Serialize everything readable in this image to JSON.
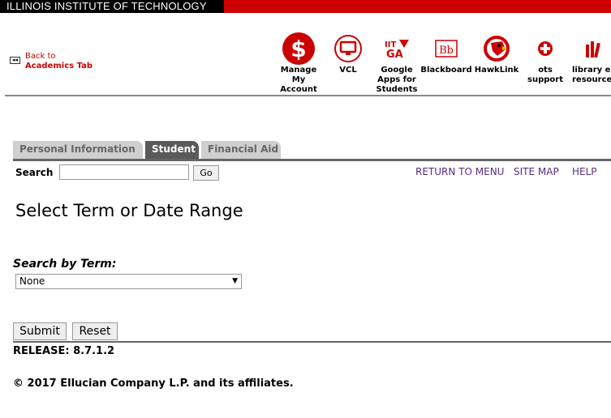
{
  "banner": {
    "title": "ILLINOIS INSTITUTE OF TECHNOLOGY"
  },
  "back": {
    "line1": "Back to",
    "line2": "Academics Tab",
    "icon": "double-left-arrow-icon"
  },
  "quick_links": [
    {
      "label": "Manage\nMy\nAccount",
      "icon": "dollar-icon"
    },
    {
      "label": "VCL",
      "icon": "monitor-icon"
    },
    {
      "label": "Google\nApps for\nStudents",
      "icon": "iit-ga-icon"
    },
    {
      "label": "Blackboard",
      "icon": "bb-icon"
    },
    {
      "label": "HawkLink",
      "icon": "hawk-icon"
    },
    {
      "label": "ots\nsupport",
      "icon": "red-cross-icon"
    },
    {
      "label": "library e\nresource",
      "icon": "books-icon"
    }
  ],
  "tabs": [
    {
      "label": "Personal Information",
      "active": false
    },
    {
      "label": "Student",
      "active": true
    },
    {
      "label": "Financial Aid",
      "active": false
    }
  ],
  "search": {
    "label": "Search",
    "value": "",
    "go_label": "Go"
  },
  "nav_links": {
    "return": "RETURN TO MENU",
    "sitemap": "SITE MAP",
    "help": "HELP"
  },
  "page": {
    "title": "Select Term or Date Range"
  },
  "term": {
    "label": "Search by Term:",
    "selected": "None"
  },
  "actions": {
    "submit": "Submit",
    "reset": "Reset"
  },
  "footer": {
    "release": "RELEASE: 8.7.1.2",
    "copyright": "© 2017 Ellucian Company L.P. and its affiliates."
  },
  "colors": {
    "brand_red": "#cc0000",
    "link_purple": "#5b2c83",
    "tab_active": "#5a5a5a",
    "tab_inactive": "#cfcfcf"
  }
}
